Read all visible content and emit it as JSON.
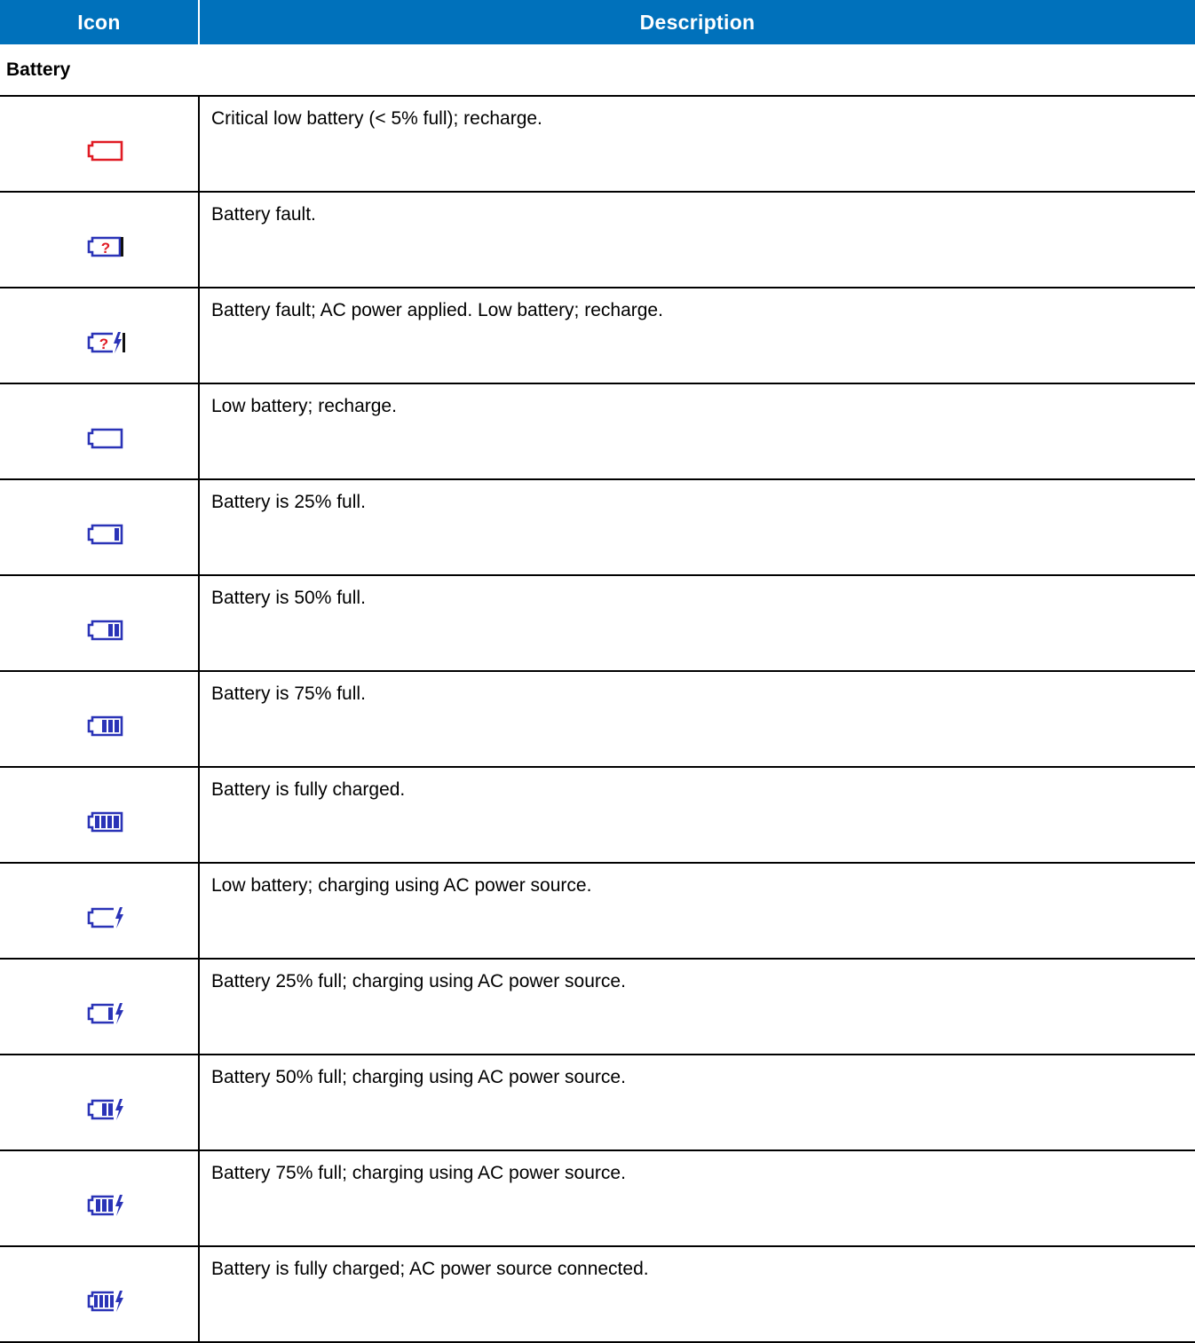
{
  "header": {
    "icon_col": "Icon",
    "desc_col": "Description"
  },
  "colors": {
    "header_bg": "#0071bb",
    "icon_blue": "#2a33b7",
    "icon_red": "#e01b24"
  },
  "section": {
    "title": "Battery"
  },
  "rows": [
    {
      "icon": "battery-critical-icon",
      "description": "Critical low battery (< 5% full); recharge."
    },
    {
      "icon": "battery-fault-icon",
      "description": "Battery fault."
    },
    {
      "icon": "battery-fault-ac-icon",
      "description": "Battery fault; AC power applied. Low battery; recharge."
    },
    {
      "icon": "battery-low-icon",
      "description": "Low battery; recharge."
    },
    {
      "icon": "battery-25-icon",
      "description": "Battery is 25% full."
    },
    {
      "icon": "battery-50-icon",
      "description": "Battery is 50% full."
    },
    {
      "icon": "battery-75-icon",
      "description": "Battery is 75% full."
    },
    {
      "icon": "battery-full-icon",
      "description": "Battery is fully charged."
    },
    {
      "icon": "battery-low-charging-icon",
      "description": "Low battery; charging using AC power source."
    },
    {
      "icon": "battery-25-charging-icon",
      "description": "Battery 25% full; charging using AC power source."
    },
    {
      "icon": "battery-50-charging-icon",
      "description": "Battery 50% full; charging using AC power source."
    },
    {
      "icon": "battery-75-charging-icon",
      "description": "Battery 75% full; charging using AC power source."
    },
    {
      "icon": "battery-full-charging-icon",
      "description": "Battery is fully charged; AC power source connected."
    }
  ]
}
